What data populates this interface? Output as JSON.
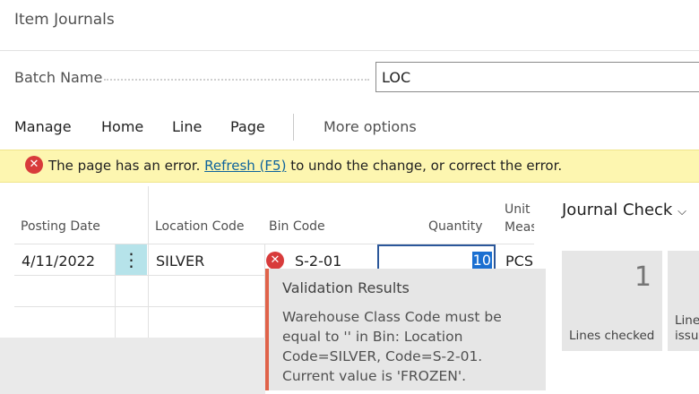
{
  "page": {
    "title": "Item Journals",
    "batch_name_label": "Batch Name",
    "batch_name_value": "LOC"
  },
  "menu": {
    "items": [
      "Manage",
      "Home",
      "Line",
      "Page"
    ],
    "more_options": "More options"
  },
  "error_bar": {
    "text_before": "The page has an error.",
    "link_text": "Refresh (F5)",
    "text_after": "to undo the change, or correct the error."
  },
  "columns": {
    "posting_date": "Posting Date",
    "location_code": "Location Code",
    "bin_code": "Bin Code",
    "quantity": "Quantity",
    "unit_of_measure_line1": "Unit o",
    "unit_of_measure_line2": "Meas"
  },
  "row": {
    "posting_date": "4/11/2022",
    "row_menu_icon": "⋮",
    "location_code": "SILVER",
    "bin_code": "S-2-01",
    "quantity": "10",
    "unit_of_measure": "PCS"
  },
  "tooltip": {
    "title": "Validation Results",
    "body": "Warehouse Class Code must be equal to '' in Bin: Location Code=SILVER, Code=S-2-01. Current value is 'FROZEN'."
  },
  "journal_check": {
    "title": "Journal Check",
    "tiles": [
      {
        "value": "1",
        "label": "Lines checked"
      },
      {
        "value": "",
        "label_line1": "Lines",
        "label_line2": "issue"
      }
    ]
  },
  "colors": {
    "error_bar_bg": "#fdf6b0",
    "error_icon": "#d83b3b",
    "link": "#0e639c",
    "tooltip_accent": "#e0634a",
    "row_menu_bg": "#b6e3ea",
    "selection": "#1a6fd1"
  },
  "icons": {
    "error_icon": "error-circle-icon",
    "chevron": "chevron-down-icon",
    "row_menu": "more-vertical-icon"
  }
}
